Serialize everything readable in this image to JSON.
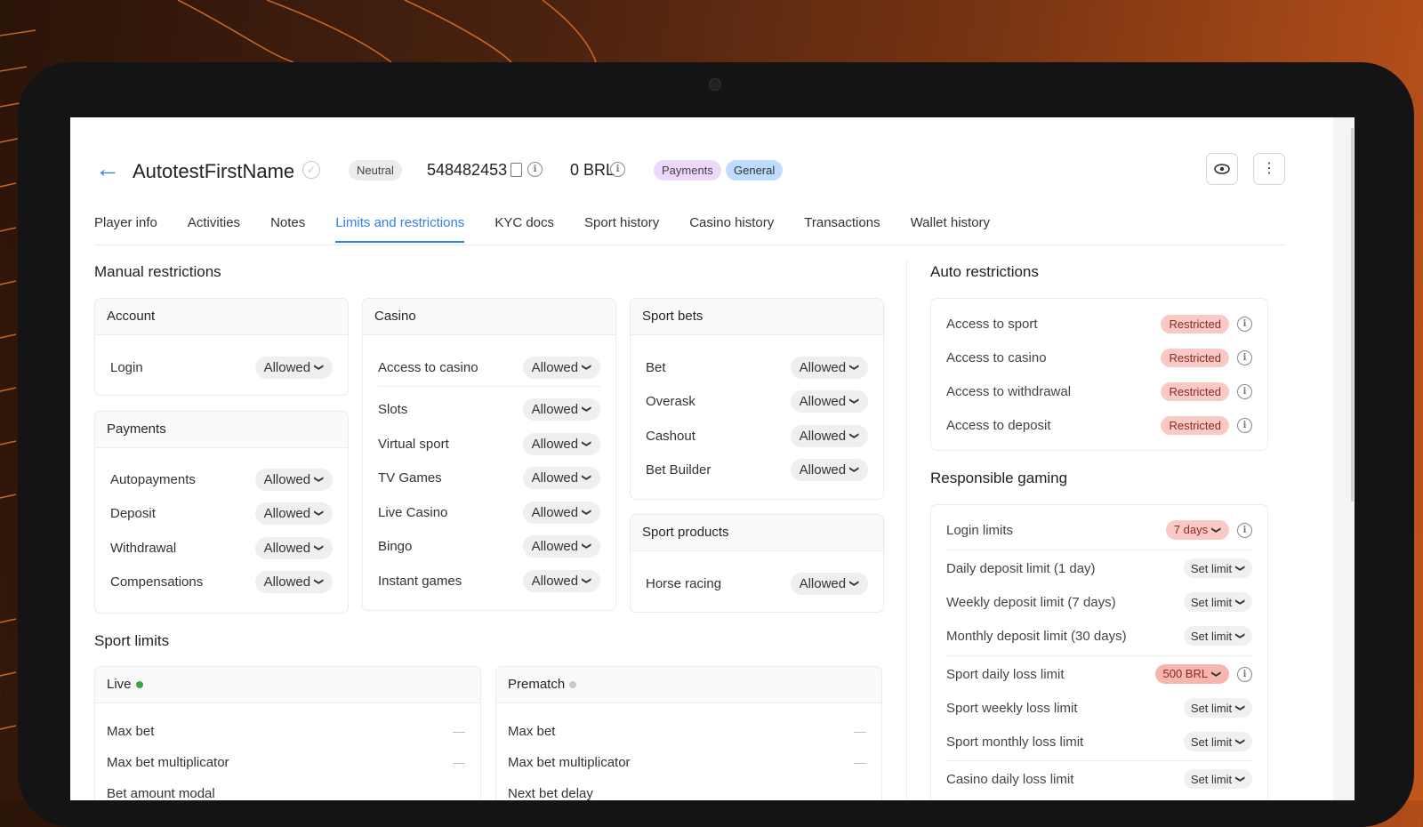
{
  "player": {
    "name": "AutotestFirstName",
    "status_badge": "Neutral",
    "id": "548482453",
    "balance": "0 BRL",
    "tags": [
      "Payments",
      "General"
    ]
  },
  "tabs": [
    {
      "label": "Player info",
      "active": false
    },
    {
      "label": "Activities",
      "active": false
    },
    {
      "label": "Notes",
      "active": false
    },
    {
      "label": "Limits and restrictions",
      "active": true
    },
    {
      "label": "KYC docs",
      "active": false
    },
    {
      "label": "Sport history",
      "active": false
    },
    {
      "label": "Casino history",
      "active": false
    },
    {
      "label": "Transactions",
      "active": false
    },
    {
      "label": "Wallet history",
      "active": false
    }
  ],
  "manual": {
    "title": "Manual restrictions",
    "account": {
      "title": "Account",
      "items": [
        {
          "label": "Login",
          "value": "Allowed"
        }
      ]
    },
    "payments": {
      "title": "Payments",
      "items": [
        {
          "label": "Autopayments",
          "value": "Allowed"
        },
        {
          "label": "Deposit",
          "value": "Allowed"
        },
        {
          "label": "Withdrawal",
          "value": "Allowed"
        },
        {
          "label": "Compensations",
          "value": "Allowed"
        }
      ]
    },
    "casino": {
      "title": "Casino",
      "items": [
        {
          "label": "Access to casino",
          "value": "Allowed"
        },
        {
          "label": "Slots",
          "value": "Allowed"
        },
        {
          "label": "Virtual sport",
          "value": "Allowed"
        },
        {
          "label": "TV Games",
          "value": "Allowed"
        },
        {
          "label": "Live Casino",
          "value": "Allowed"
        },
        {
          "label": "Bingo",
          "value": "Allowed"
        },
        {
          "label": "Instant games",
          "value": "Allowed"
        }
      ]
    },
    "sport_bets": {
      "title": "Sport bets",
      "items": [
        {
          "label": "Bet",
          "value": "Allowed"
        },
        {
          "label": "Overask",
          "value": "Allowed"
        },
        {
          "label": "Cashout",
          "value": "Allowed"
        },
        {
          "label": "Bet Builder",
          "value": "Allowed"
        }
      ]
    },
    "sport_products": {
      "title": "Sport products",
      "items": [
        {
          "label": "Horse racing",
          "value": "Allowed"
        }
      ]
    }
  },
  "sport_limits": {
    "title": "Sport limits",
    "live": {
      "title": "Live",
      "dot_color": "#3aa84a",
      "rows": [
        {
          "label": "Max bet",
          "value": "—"
        },
        {
          "label": "Max bet multiplicator",
          "value": "—"
        },
        {
          "label": "Bet amount modal",
          "value": ""
        }
      ]
    },
    "prematch": {
      "title": "Prematch",
      "dot_color": "#c8c8c8",
      "rows": [
        {
          "label": "Max bet",
          "value": "—"
        },
        {
          "label": "Max bet multiplicator",
          "value": "—"
        },
        {
          "label": "Next bet delay",
          "value": ""
        }
      ]
    }
  },
  "auto": {
    "title": "Auto restrictions",
    "items": [
      {
        "label": "Access to sport",
        "value": "Restricted"
      },
      {
        "label": "Access to casino",
        "value": "Restricted"
      },
      {
        "label": "Access to withdrawal",
        "value": "Restricted"
      },
      {
        "label": "Access to deposit",
        "value": "Restricted"
      }
    ]
  },
  "responsible": {
    "title": "Responsible gaming",
    "items": [
      {
        "label": "Login limits",
        "value": "7 days",
        "active": true,
        "info": true
      },
      {
        "label": "Daily deposit limit (1 day)",
        "value": "Set limit",
        "active": false,
        "info": false
      },
      {
        "label": "Weekly deposit limit (7 days)",
        "value": "Set limit",
        "active": false,
        "info": false
      },
      {
        "label": "Monthly deposit limit (30 days)",
        "value": "Set limit",
        "active": false,
        "info": false
      },
      {
        "label": "Sport daily loss limit",
        "value": "500 BRL",
        "active": true,
        "info": true
      },
      {
        "label": "Sport weekly loss limit",
        "value": "Set limit",
        "active": false,
        "info": false
      },
      {
        "label": "Sport monthly loss limit",
        "value": "Set limit",
        "active": false,
        "info": false
      },
      {
        "label": "Casino daily loss limit",
        "value": "Set limit",
        "active": false,
        "info": false
      }
    ]
  },
  "colors": {
    "accent": "#2f80ed",
    "restricted_bg": "#f9c9c5",
    "tag_payments": "#ead9fb",
    "tag_general": "#bfdcff"
  }
}
